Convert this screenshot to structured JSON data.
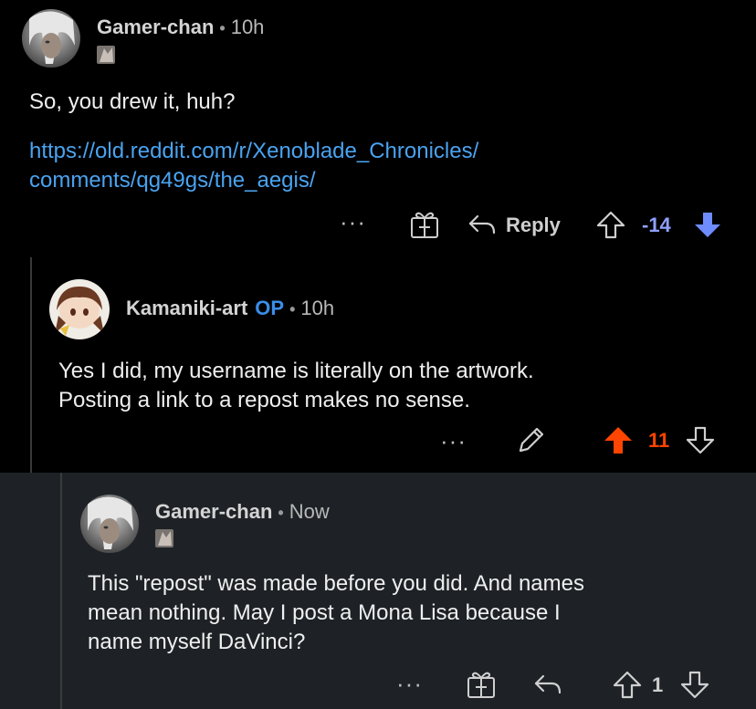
{
  "comments": [
    {
      "username": "Gamer-chan",
      "separator": "•",
      "time": "10h",
      "text_line1": "So, you drew it, huh?",
      "link_line1": "https://old.reddit.com/r/Xenoblade_Chronicles/",
      "link_line2": "comments/qg49gs/the_aegis/",
      "actions": {
        "more": "···",
        "reply_label": "Reply",
        "score": "-14",
        "vote_state": "downvoted"
      }
    },
    {
      "username": "Kamaniki-art",
      "op_badge": "OP",
      "separator": "•",
      "time": "10h",
      "text_line1": "Yes I did, my username is literally on the artwork.",
      "text_line2": "Posting a link to a repost makes no sense.",
      "actions": {
        "more": "···",
        "score": "11",
        "vote_state": "upvoted"
      }
    },
    {
      "username": "Gamer-chan",
      "separator": "•",
      "time": "Now",
      "text_line1": "This \"repost\" was made before you did. And names",
      "text_line2": "mean nothing. May I post a Mona Lisa because I",
      "text_line3": "name myself DaVinci?",
      "actions": {
        "more": "···",
        "score": "1",
        "vote_state": "none"
      }
    }
  ],
  "colors": {
    "background": "#000000",
    "highlight_background": "#1e2226",
    "link": "#4aa3f0",
    "op_badge": "#3b8de8",
    "downvote": "#8ea0ff",
    "upvote": "#ff4500"
  }
}
